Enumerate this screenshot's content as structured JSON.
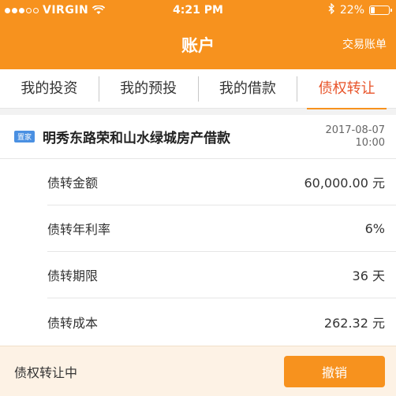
{
  "status_bar": {
    "carrier": "VIRGIN",
    "time": "4:21 PM",
    "battery": "22%",
    "battery_level": 0.22,
    "signal_filled": 3,
    "signal_total": 5
  },
  "nav": {
    "title": "账户",
    "right_action": "交易账单"
  },
  "tabs": [
    {
      "label": "我的投资"
    },
    {
      "label": "我的预投"
    },
    {
      "label": "我的借款"
    },
    {
      "label": "债权转让",
      "active": true
    }
  ],
  "loan": {
    "tag": "置家",
    "name": "明秀东路荣和山水绿城房产借款",
    "date": "2017-08-07",
    "time": "10:00",
    "details": [
      {
        "label": "债转金额",
        "value": "60,000.00 元"
      },
      {
        "label": "债转年利率",
        "value": "6%"
      },
      {
        "label": "债转期限",
        "value": "36 天"
      },
      {
        "label": "债转成本",
        "value": "262.32 元"
      }
    ]
  },
  "footer": {
    "status": "债权转让中",
    "cancel_label": "撤销"
  },
  "colors": {
    "accent": "#f7921e",
    "active_tab": "#e8542a",
    "tag": "#4a90e2",
    "footer_bg": "#fdf2e5"
  },
  "icons": [
    "wifi-icon",
    "bluetooth-icon",
    "battery-icon"
  ]
}
